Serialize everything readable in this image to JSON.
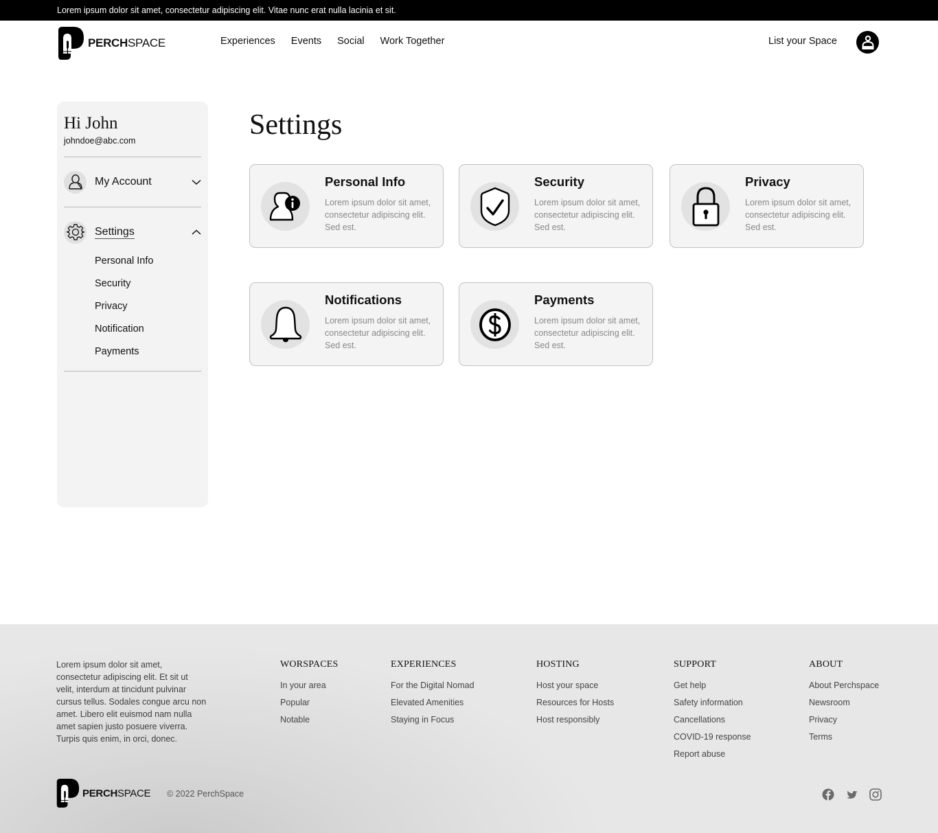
{
  "announcement": "Lorem ipsum dolor sit amet, consectetur adipiscing elit. Vitae nunc erat nulla lacinia et sit.",
  "brand": {
    "bold": "PERCH",
    "light": "SPACE"
  },
  "nav": {
    "items": [
      "Experiences",
      "Events",
      "Social",
      "Work Together"
    ],
    "list_space": "List your Space",
    "profile_icon": "user-circle-icon"
  },
  "sidebar": {
    "greeting": "Hi John",
    "email": "johndoe@abc.com",
    "sections": [
      {
        "label": "My Account",
        "icon": "user-icon",
        "expanded": false,
        "chevron": "chevron-down-icon"
      },
      {
        "label": "Settings",
        "icon": "gear-icon",
        "expanded": true,
        "chevron": "chevron-up-icon",
        "items": [
          "Personal Info",
          "Security",
          "Privacy",
          "Notification",
          "Payments"
        ]
      }
    ]
  },
  "main": {
    "title": "Settings",
    "cards": [
      {
        "title": "Personal Info",
        "icon": "user-info-icon",
        "description": "Lorem ipsum dolor sit amet, consectetur adipiscing elit. Sed est."
      },
      {
        "title": "Security",
        "icon": "shield-check-icon",
        "description": "Lorem ipsum dolor sit amet, consectetur adipiscing elit. Sed est."
      },
      {
        "title": "Privacy",
        "icon": "lock-icon",
        "description": "Lorem ipsum dolor sit amet, consectetur adipiscing elit. Sed est."
      },
      {
        "title": "Notifications",
        "icon": "bell-icon",
        "description": "Lorem ipsum dolor sit amet, consectetur adipiscing elit. Sed est."
      },
      {
        "title": "Payments",
        "icon": "dollar-coin-icon",
        "description": "Lorem ipsum dolor sit amet, consectetur adipiscing elit. Sed est."
      }
    ]
  },
  "footer": {
    "about_text": "Lorem ipsum dolor sit amet, consectetur adipiscing elit. Et sit ut velit, interdum at tincidunt pulvinar cursus tellus. Sodales congue arcu non amet. Libero elit euismod nam nulla amet sapien justo posuere viverra. Turpis quis enim, in orci, donec.",
    "columns": [
      {
        "heading": "WORSPACES",
        "links": [
          "In your area",
          "Popular",
          "Notable"
        ]
      },
      {
        "heading": "EXPERIENCES",
        "links": [
          "For the Digital Nomad",
          "Elevated Amenities",
          "Staying in Focus"
        ]
      },
      {
        "heading": "HOSTING",
        "links": [
          "Host your space",
          "Resources for Hosts",
          "Host responsibly"
        ]
      },
      {
        "heading": "SUPPORT",
        "links": [
          "Get help",
          "Safety information",
          "Cancellations",
          "COVID-19 response",
          "Report abuse"
        ]
      },
      {
        "heading": "ABOUT",
        "links": [
          "About Perchspace",
          "Newsroom",
          "Privacy",
          "Terms"
        ]
      }
    ],
    "copyright": "© 2022 PerchSpace",
    "social": [
      "facebook-icon",
      "twitter-icon",
      "instagram-icon"
    ]
  }
}
